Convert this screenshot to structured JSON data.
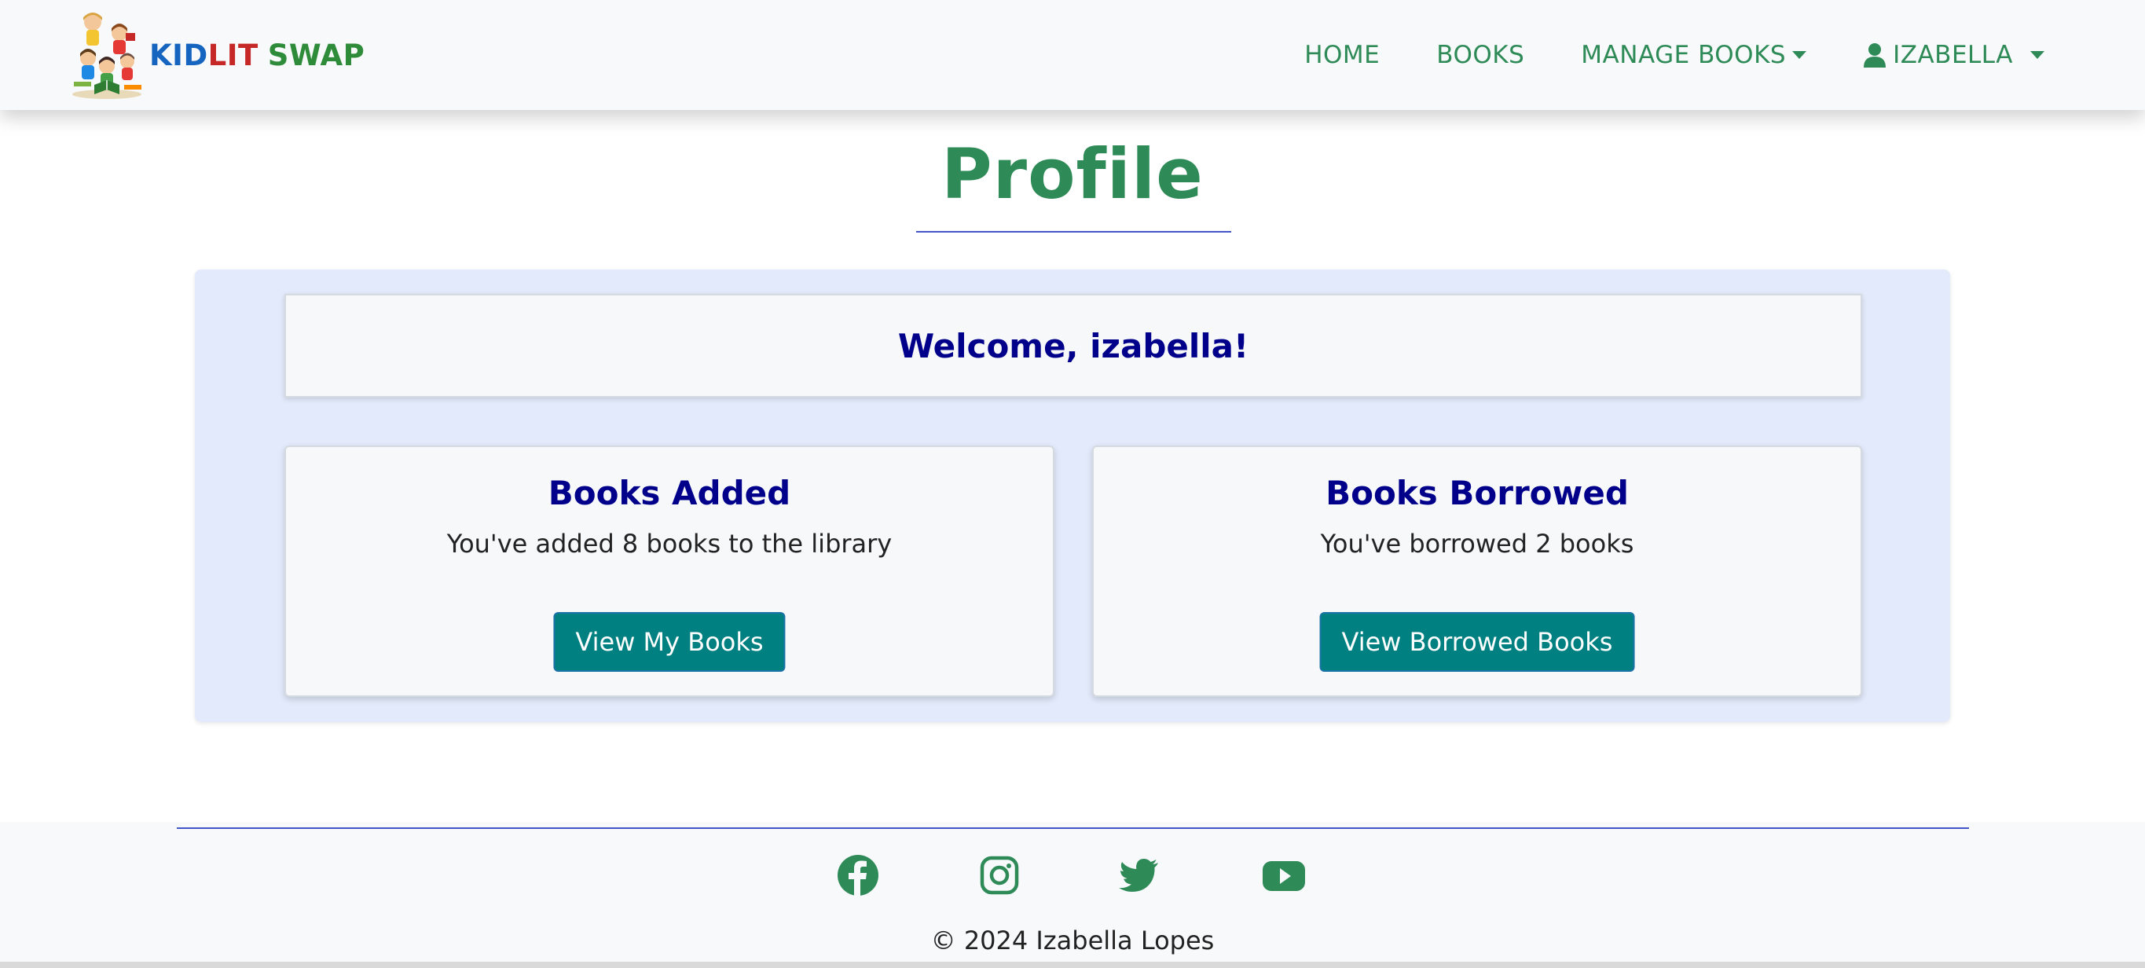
{
  "brand": {
    "word1": "KID",
    "word2": "LIT",
    "word3": "SWAP",
    "logo_icon": "kids-reading-logo"
  },
  "nav": {
    "home": "HOME",
    "books": "BOOKS",
    "manage_books": "MANAGE BOOKS",
    "user": "IZABELLA",
    "user_icon": "user-icon"
  },
  "page": {
    "title": "Profile"
  },
  "welcome": {
    "text": "Welcome, izabella!"
  },
  "cards": {
    "added": {
      "title": "Books Added",
      "text": "You've added 8 books to the library",
      "button": "View My Books"
    },
    "borrowed": {
      "title": "Books Borrowed",
      "text": "You've borrowed 2 books",
      "button": "View Borrowed Books"
    }
  },
  "footer": {
    "socials": [
      "facebook-icon",
      "instagram-icon",
      "twitter-icon",
      "youtube-icon"
    ],
    "copyright": "© 2024 Izabella Lopes"
  },
  "colors": {
    "accent_green": "#2e8b57",
    "heading_navy": "#00008b",
    "button_teal": "#008080",
    "panel_bg": "#e2eafb",
    "divider_blue": "#4356c9"
  }
}
